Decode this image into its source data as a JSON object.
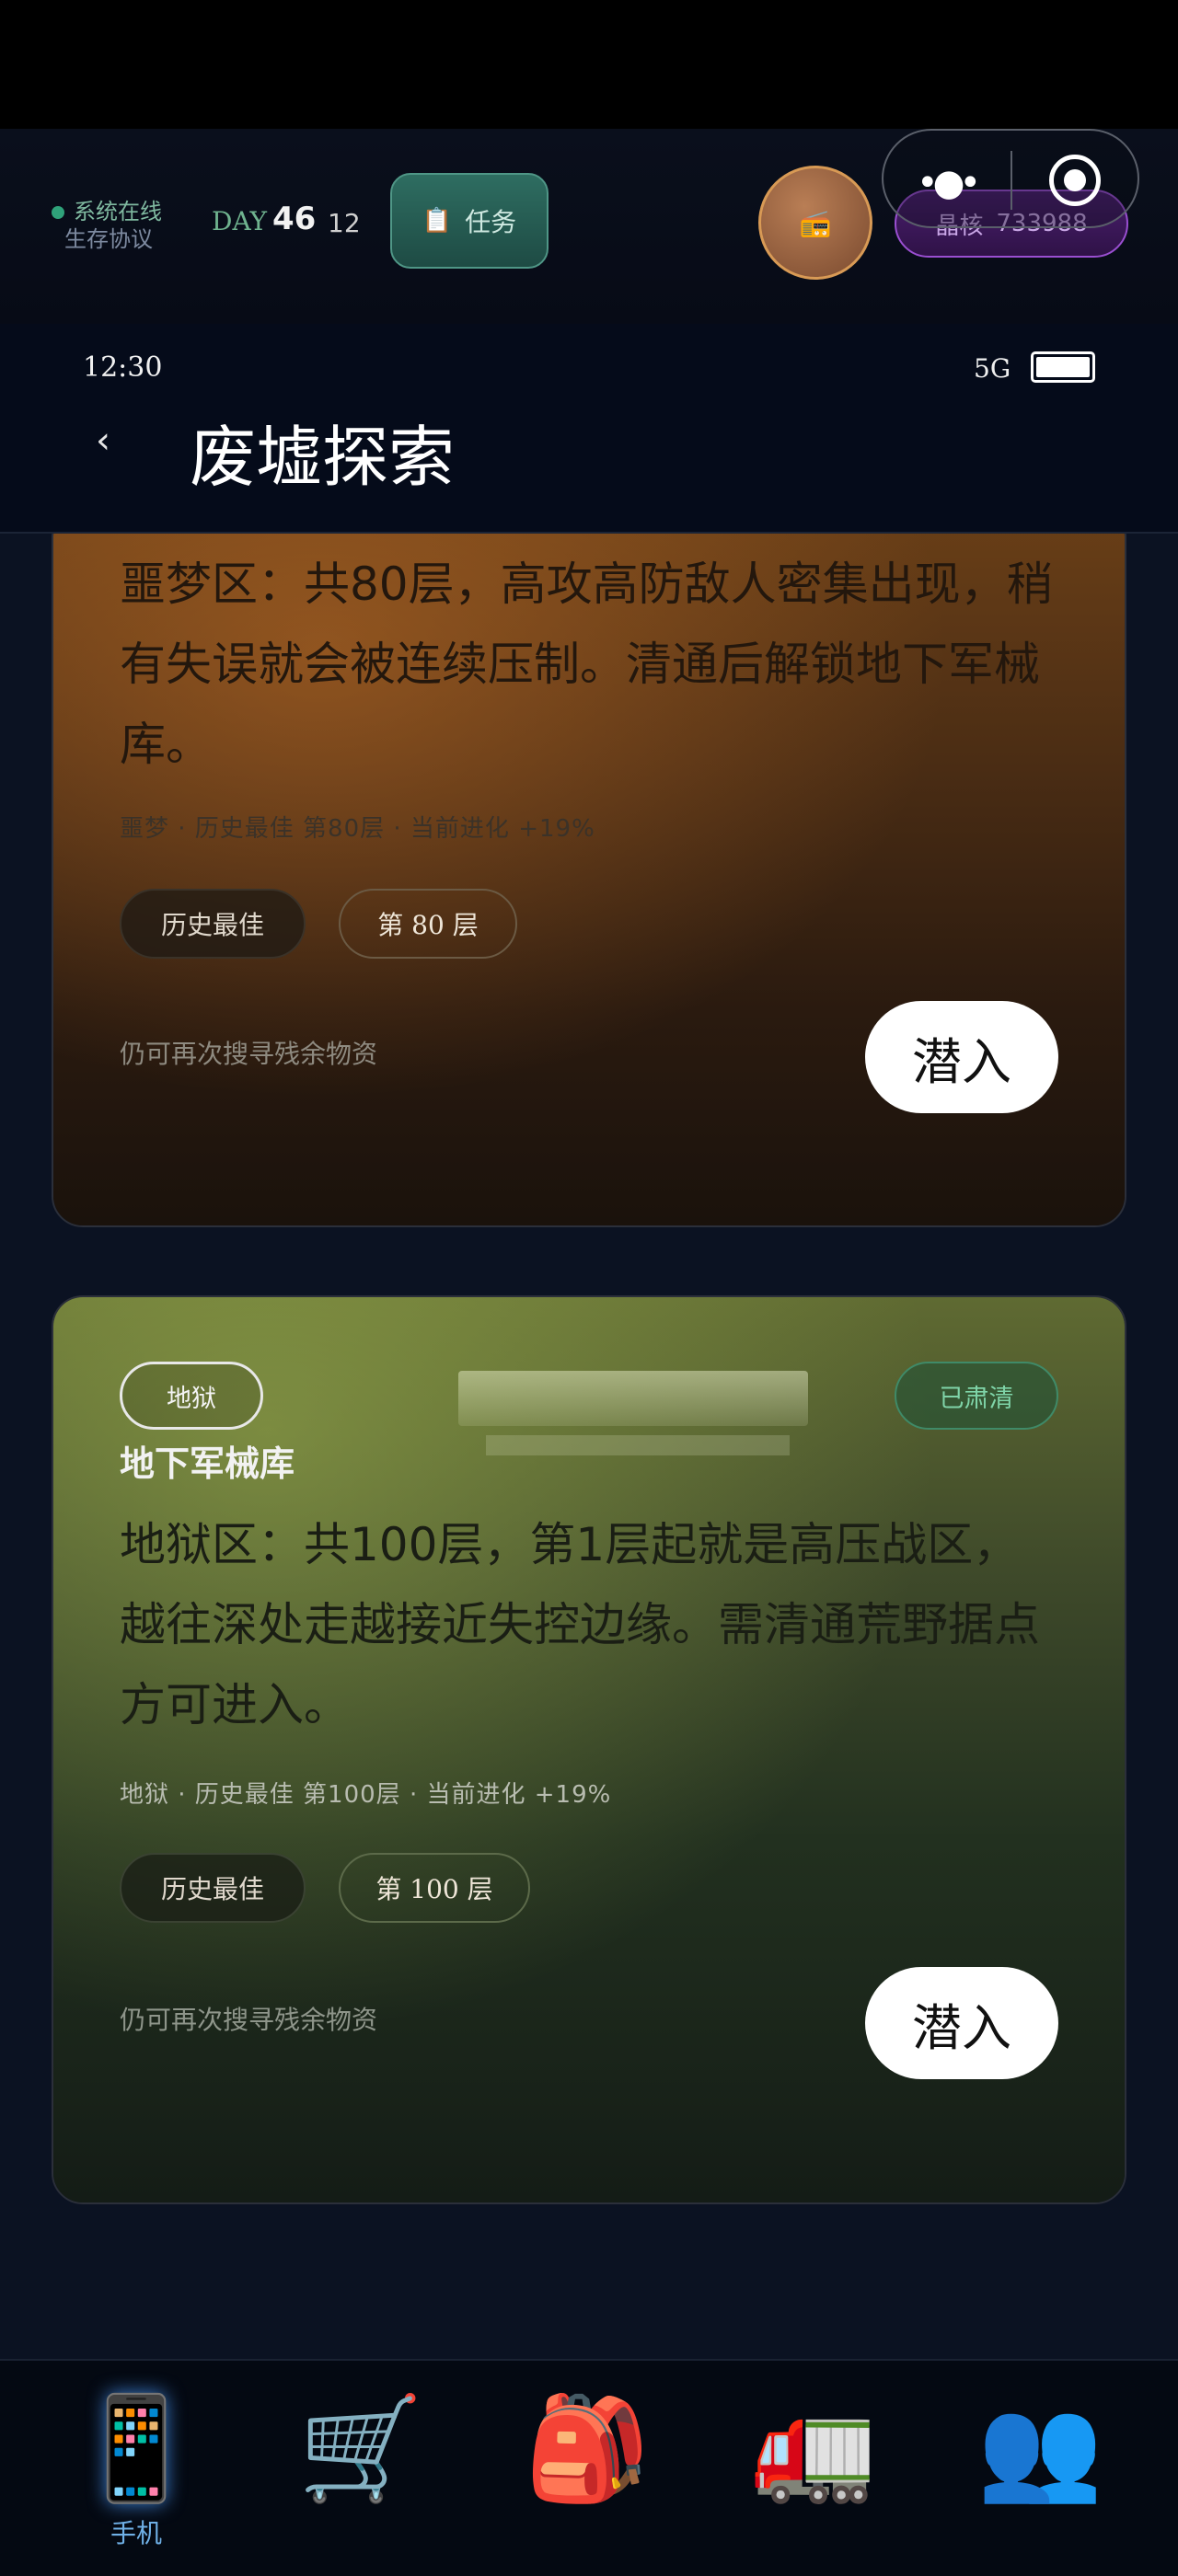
{
  "hud": {
    "online_label": "系统在线",
    "protocol_label": "生存协议",
    "day_label": "DAY",
    "day_number": "46",
    "day_sub": "12",
    "task_label": "任务",
    "task_icon": "clipboard-icon",
    "radio_icon": "radio-icon",
    "crystal_label": "晶核",
    "crystal_value": "733988"
  },
  "status_bar": {
    "time": "12:30",
    "network": "5G",
    "battery_level": 1.0
  },
  "header": {
    "back_label": "‹",
    "title": "废墟探索"
  },
  "cards": [
    {
      "mode": "",
      "status": "",
      "name": "",
      "description": "噩梦区：共80层，高攻高防敌人密集出现，稍有失误就会被连续压制。清通后解锁地下军械库。",
      "meta": "噩梦 · 历史最佳 第80层 · 当前进化 +19%",
      "best_label": "历史最佳",
      "floor_label": "第 80 层",
      "hint": "仍可再次搜寻残余物资",
      "enter_label": "潜入"
    },
    {
      "mode": "地狱",
      "status": "已肃清",
      "name": "地下军械库",
      "description": "地狱区：共100层，第1层起就是高压战区，越往深处走越接近失控边缘。需清通荒野据点方可进入。",
      "meta": "地狱 · 历史最佳 第100层 · 当前进化 +19%",
      "best_label": "历史最佳",
      "floor_label": "第 100 层",
      "hint": "仍可再次搜寻残余物资",
      "enter_label": "潜入"
    }
  ],
  "bottom_nav": [
    {
      "icon": "📱",
      "label": "手机"
    },
    {
      "icon": "🛒",
      "label": ""
    },
    {
      "icon": "🎒",
      "label": ""
    },
    {
      "icon": "🚛",
      "label": ""
    },
    {
      "icon": "👥",
      "label": ""
    }
  ]
}
